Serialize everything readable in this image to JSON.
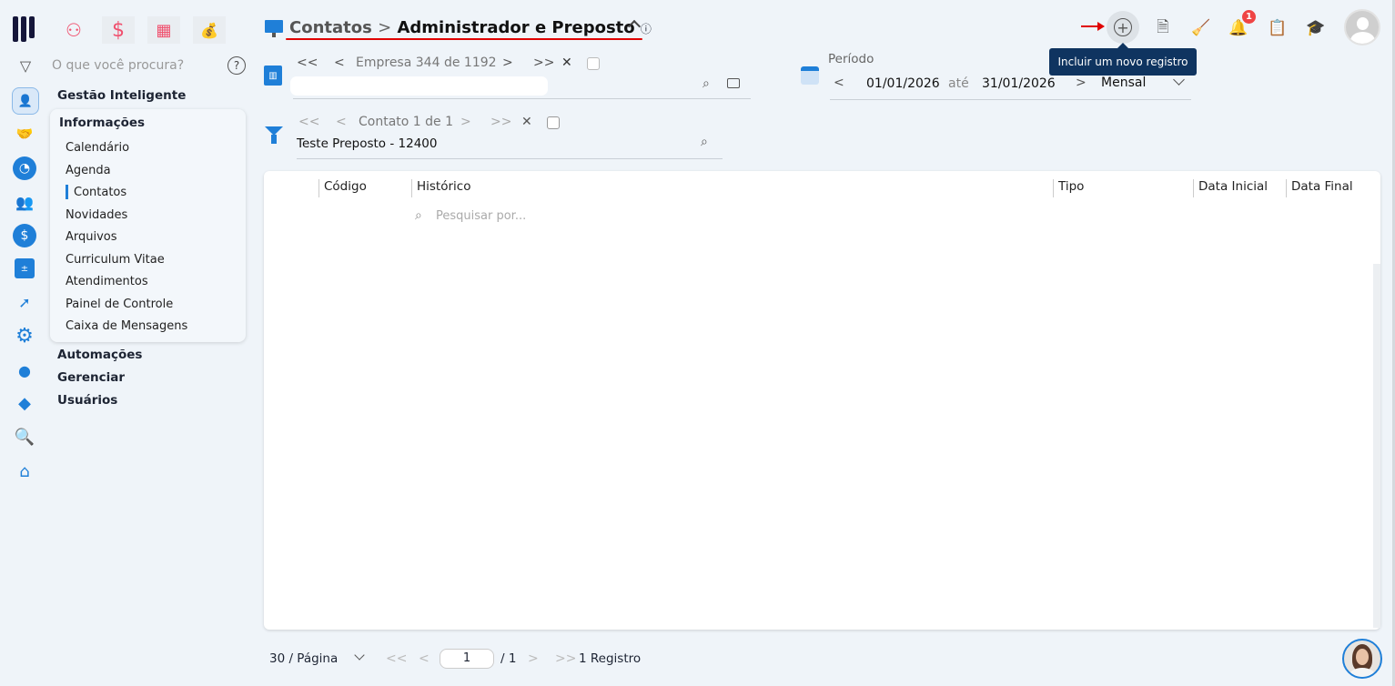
{
  "header": {
    "breadcrumb_root": "Contatos",
    "breadcrumb_sep": ">",
    "breadcrumb_current": "Administrador e Preposto",
    "info": "ⓘ",
    "collapse": "^"
  },
  "topbar": {
    "tooltip": "Incluir um novo registro",
    "notification_count": "1"
  },
  "sidebar": {
    "search_placeholder": "O que você procura?",
    "help": "?",
    "sections": [
      "Gestão Inteligente",
      "Automações",
      "Gerenciar",
      "Usuários"
    ],
    "group_title": "Informações",
    "items": [
      "Calendário",
      "Agenda",
      "Contatos",
      "Novidades",
      "Arquivos",
      "Curriculum Vitae",
      "Atendimentos",
      "Painel de Controle",
      "Caixa de Mensagens"
    ],
    "active_item": "Contatos"
  },
  "empresa": {
    "first": "<<",
    "prev": "<",
    "label": "Empresa",
    "current": "344",
    "of": "de",
    "total": "1192",
    "next": ">",
    "last": ">>",
    "clear": "✕",
    "value": ""
  },
  "contato": {
    "first": "<<",
    "prev": "<",
    "label": "Contato 1 de 1",
    "next": ">",
    "last": ">>",
    "clear": "✕",
    "value": "Teste Preposto - 12400"
  },
  "periodo": {
    "label": "Período",
    "start": "01/01/2026",
    "ate": "até",
    "end": "31/01/2026",
    "mode": "Mensal"
  },
  "table": {
    "columns": [
      "Código",
      "Histórico",
      "Tipo",
      "Data Inicial",
      "Data Final"
    ],
    "search_placeholder": "Pesquisar por..."
  },
  "pagination": {
    "per_page": "30 / Página",
    "page": "1",
    "total_pages": "/ 1",
    "records": "1 Registro"
  },
  "colors": {
    "accent": "#1f7fd8",
    "underline": "#e00000",
    "tooltip_bg": "#0f3460",
    "badge": "#ef4444",
    "alert_icon": "#f0506e"
  }
}
